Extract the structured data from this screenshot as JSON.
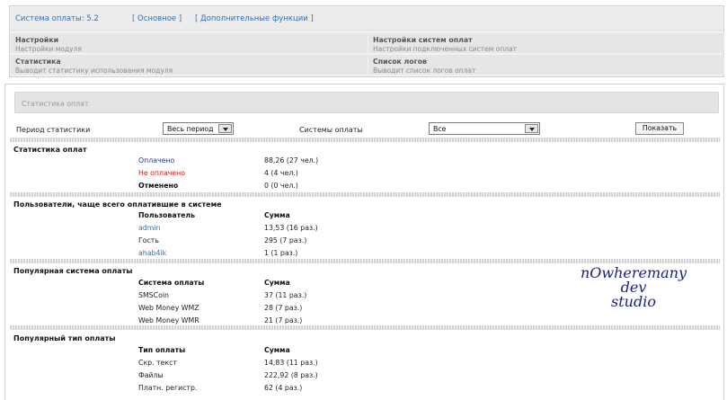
{
  "top": {
    "version_label": "Система оплаты: 5.2",
    "nav_main": "[ Основное ]",
    "nav_extra": "[ Дополнительные функции ]",
    "items": [
      {
        "title": "Настройки",
        "desc": "Настройки модуля"
      },
      {
        "title": "Настройки систем оплат",
        "desc": "Настройки подключенных систем оплат"
      },
      {
        "title": "Статистика",
        "desc": "Выводит статистику использования модуля"
      },
      {
        "title": "Список логов",
        "desc": "Выводит список логов оплат"
      }
    ]
  },
  "panel_title": "Статистика оплат",
  "filters": {
    "period_label": "Период статистики",
    "period_value": "Весь период",
    "systems_label": "Системы оплаты",
    "systems_value": "Все",
    "show_button": "Показать"
  },
  "sections": {
    "stats": {
      "title": "Статистика оплат",
      "rows": [
        {
          "label": "Оплачено",
          "value": "88,26 (27 чел.)"
        },
        {
          "label": "Не оплачено",
          "value": "4 (4 чел.)"
        },
        {
          "label": "Отменено",
          "value": "0 (0 чел.)"
        }
      ]
    },
    "users": {
      "title": "Пользователи, чаще всего оплатившие в системе",
      "col1": "Пользователь",
      "col2": "Сумма",
      "rows": [
        {
          "name": "admin",
          "value": "13,53 (16 раз.)"
        },
        {
          "name": "Гость",
          "value": "295 (7 раз.)"
        },
        {
          "name": "ahab4ik",
          "value": "1 (1 раз.)"
        }
      ]
    },
    "systems": {
      "title": "Популярная система оплаты",
      "col1": "Система оплаты",
      "col2": "Сумма",
      "rows": [
        {
          "name": "SMSCoin",
          "value": "37 (11 раз.)"
        },
        {
          "name": "Web Money WMZ",
          "value": "28 (7 раз.)"
        },
        {
          "name": "Web Money WMR",
          "value": "21 (7 раз.)"
        }
      ]
    },
    "types": {
      "title": "Популярный тип оплаты",
      "col1": "Тип оплаты",
      "col2": "Сумма",
      "rows": [
        {
          "name": "Скр. текст",
          "value": "14,83 (11 раз.)"
        },
        {
          "name": "Файлы",
          "value": "222,92 (8 раз.)"
        },
        {
          "name": "Платн. регистр.",
          "value": "62 (4 раз.)"
        }
      ]
    }
  },
  "logo": {
    "line1": "nOwheremany",
    "line2": "dev",
    "line3": "studio"
  },
  "colors": {
    "link": "#3a6ea5",
    "paid": "#1f3a93",
    "unpaid": "#cc1a1a",
    "logo": "#1a1f7a"
  }
}
